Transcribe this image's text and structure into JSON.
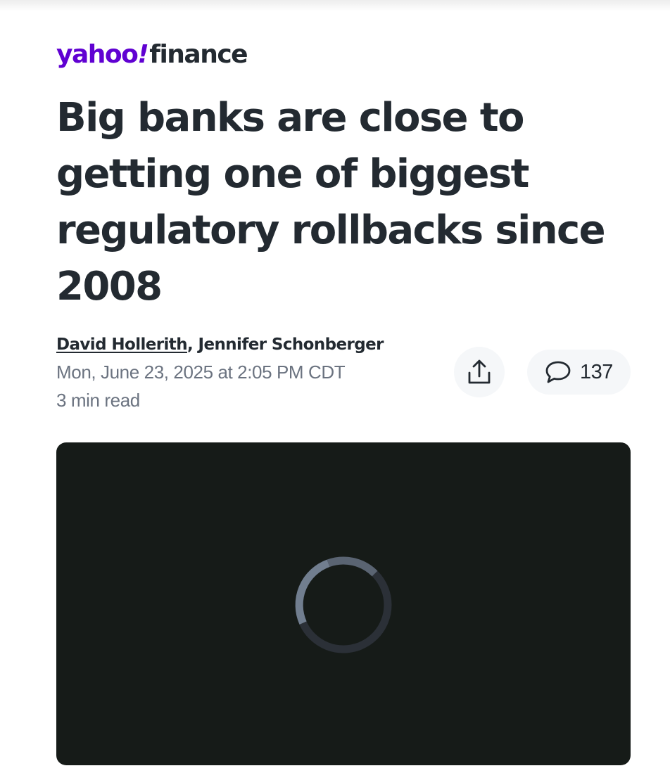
{
  "colors": {
    "brand": "#6001d2",
    "ink": "#232a31",
    "meta": "#6b7380",
    "video_bg": "#161b18"
  },
  "logo": {
    "yahoo": "yahoo",
    "exclaim": "!",
    "finance": "finance"
  },
  "article": {
    "headline": "Big banks are close to getting one of biggest regulatory rollbacks since 2008",
    "author_1": "David Hollerith",
    "author_separator": ", ",
    "author_2": "Jennifer Schonberger",
    "date": "Mon, June 23, 2025 at 2:05 PM CDT",
    "read_time": "3 min read"
  },
  "actions": {
    "share_icon": "share-upload-icon",
    "comment_icon": "speech-bubble-icon",
    "comment_count": "137"
  },
  "video": {
    "state": "loading",
    "spinner_icon": "loading-spinner-icon"
  }
}
